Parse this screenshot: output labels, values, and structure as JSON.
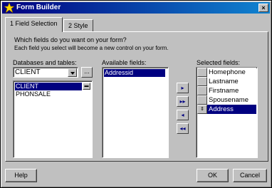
{
  "window": {
    "title": "Form Builder",
    "close_label": "×"
  },
  "tabs": [
    {
      "label": "1 Field Selection"
    },
    {
      "label": "2 Style"
    }
  ],
  "instructions": {
    "line1": "Which fields do you want on your form?",
    "line2": "Each field you select will become a new control on your form."
  },
  "databases": {
    "label": "Databases and tables:",
    "selected": "CLIENT",
    "browse_label": "...",
    "tables": [
      "CLIENT",
      "PHONSALE"
    ]
  },
  "available": {
    "label": "Available fields:",
    "fields": [
      "Addressid"
    ]
  },
  "move_buttons": {
    "add": "▸",
    "add_all": "▸▸",
    "remove": "◂",
    "remove_all": "◂◂"
  },
  "selected": {
    "label": "Selected fields:",
    "fields": [
      "Homephone",
      "Lastname",
      "Firstname",
      "Spousename",
      "Address"
    ],
    "mover_glyph": "⇕"
  },
  "buttons": {
    "help": "Help",
    "ok": "OK",
    "cancel": "Cancel"
  },
  "colors": {
    "title_start": "#000080",
    "title_end": "#1084d0",
    "selection": "#000080",
    "face": "#c0c0c0"
  }
}
